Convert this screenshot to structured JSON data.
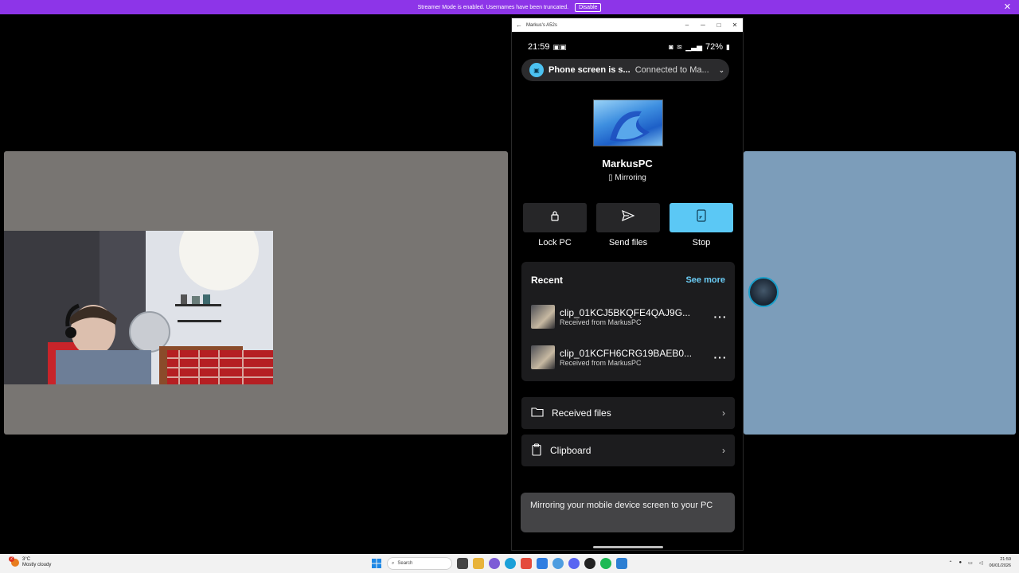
{
  "streamer": {
    "message": "Streamer Mode is enabled. Usernames have been truncated.",
    "disable_label": "Disable",
    "close_glyph": "✕"
  },
  "phone_window": {
    "title": "Markus's A52s",
    "status": {
      "time": "21:59",
      "battery": "72%"
    },
    "notification": {
      "title": "Phone screen is s...",
      "subtitle": "Connected to Ma..."
    },
    "device": {
      "name": "MarkusPC",
      "status": "Mirroring"
    },
    "actions": [
      {
        "label": "Lock PC",
        "icon": "lock-icon"
      },
      {
        "label": "Send files",
        "icon": "send-icon"
      },
      {
        "label": "Stop",
        "icon": "phone-cast-icon"
      }
    ],
    "recent": {
      "title": "Recent",
      "see_more": "See more",
      "items": [
        {
          "name": "clip_01KCJ5BKQFE4QAJ9G...",
          "sub": "Received from MarkusPC"
        },
        {
          "name": "clip_01KCFH6CRG19BAEB0...",
          "sub": "Received from MarkusPC"
        }
      ]
    },
    "rows": [
      {
        "label": "Received files",
        "icon": "folder-icon"
      },
      {
        "label": "Clipboard",
        "icon": "clipboard-icon"
      }
    ],
    "toast": "Mirroring your mobile device screen to your PC"
  },
  "taskbar": {
    "weather": {
      "temp": "3°C",
      "desc": "Mostly cloudy",
      "badge": "2"
    },
    "search_placeholder": "Search",
    "clock": {
      "time": "21:59",
      "date": "06/01/2026"
    }
  },
  "colors": {
    "streamer_bar": "#8d35e8",
    "accent": "#5bc8f5",
    "stage_left": "#787572",
    "stage_right": "#7c9dba"
  }
}
